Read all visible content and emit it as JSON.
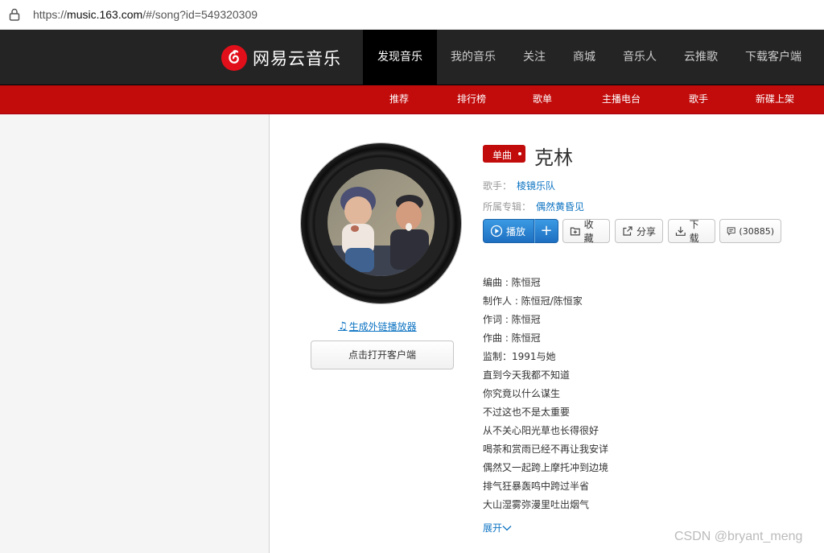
{
  "browser": {
    "url_prefix": "https://",
    "url_host": "music.163.com",
    "url_path": "/#/song?id=549320309"
  },
  "brand": {
    "name": "网易云音乐",
    "color": "#e10f1a"
  },
  "nav": {
    "items": [
      {
        "label": "发现音乐",
        "active": true
      },
      {
        "label": "我的音乐"
      },
      {
        "label": "关注"
      },
      {
        "label": "商城"
      },
      {
        "label": "音乐人"
      },
      {
        "label": "云推歌"
      },
      {
        "label": "下载客户端"
      }
    ]
  },
  "subnav": {
    "items": [
      "推荐",
      "排行榜",
      "歌单",
      "主播电台",
      "歌手",
      "新碟上架"
    ],
    "color": "#c20c0c"
  },
  "player": {
    "gen_link": "生成外链播放器",
    "open_client": "点击打开客户端"
  },
  "song": {
    "badge": "单曲",
    "title": "克林",
    "artist_label": "歌手：",
    "artist": "棱镜乐队",
    "album_label": "所属专辑：",
    "album": "偶然黄昏见"
  },
  "actions": {
    "play": "播放",
    "add": "+",
    "collect": "收藏",
    "share": "分享",
    "download": "下载",
    "comments": "(30885)"
  },
  "lyrics": [
    "编曲 : 陈恒冠",
    "制作人 : 陈恒冠/陈恒家",
    "作词 : 陈恒冠",
    "作曲 : 陈恒冠",
    "监制：1991与她",
    "直到今天我都不知道",
    "你究竟以什么谋生",
    "不过这也不是太重要",
    "从不关心阳光草也长得很好",
    "喝茶和赏雨已经不再让我安详",
    "偶然又一起跨上摩托冲到边境",
    "排气狂暴轰鸣中跨过半省",
    "大山湿雾弥漫里吐出烟气"
  ],
  "expand": "展开",
  "watermark": "CSDN @bryant_meng"
}
